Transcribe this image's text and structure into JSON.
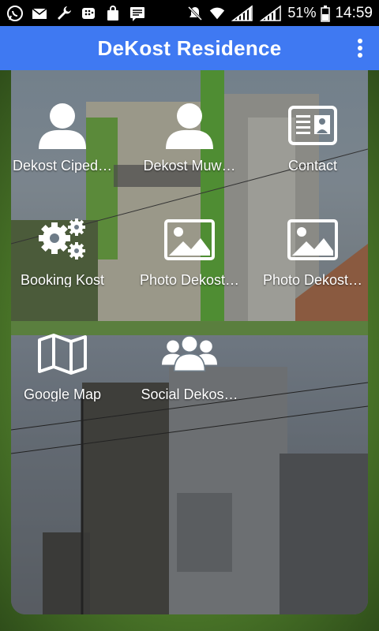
{
  "status_bar": {
    "left_icons": [
      "whatsapp-icon",
      "mail-icon",
      "wrench-icon",
      "bbm-icon",
      "shopping-bag-icon",
      "message-icon"
    ],
    "right_icons": [
      "mute-icon",
      "wifi-icon",
      "signal-icon",
      "signal-icon",
      "battery-icon"
    ],
    "battery": "51%",
    "time": "14:59"
  },
  "app_bar": {
    "title": "DeKost Residence",
    "menu_icon": "overflow-menu-icon"
  },
  "colors": {
    "app_bar": "#3f79f2",
    "status_bar": "#000000",
    "background_accent": "#6f9a4a"
  },
  "tiles": [
    {
      "label": "Dekost Ciped…",
      "icon": "person-icon"
    },
    {
      "label": "Dekost Muw…",
      "icon": "person-icon"
    },
    {
      "label": "Contact",
      "icon": "contact-card-icon"
    },
    {
      "label": "Booking Kost",
      "icon": "gears-icon"
    },
    {
      "label": "Photo Dekost…",
      "icon": "image-icon"
    },
    {
      "label": "Photo Dekost…",
      "icon": "image-icon"
    },
    {
      "label": "Google Map",
      "icon": "map-icon"
    },
    {
      "label": "Social Dekos…",
      "icon": "group-icon"
    }
  ]
}
